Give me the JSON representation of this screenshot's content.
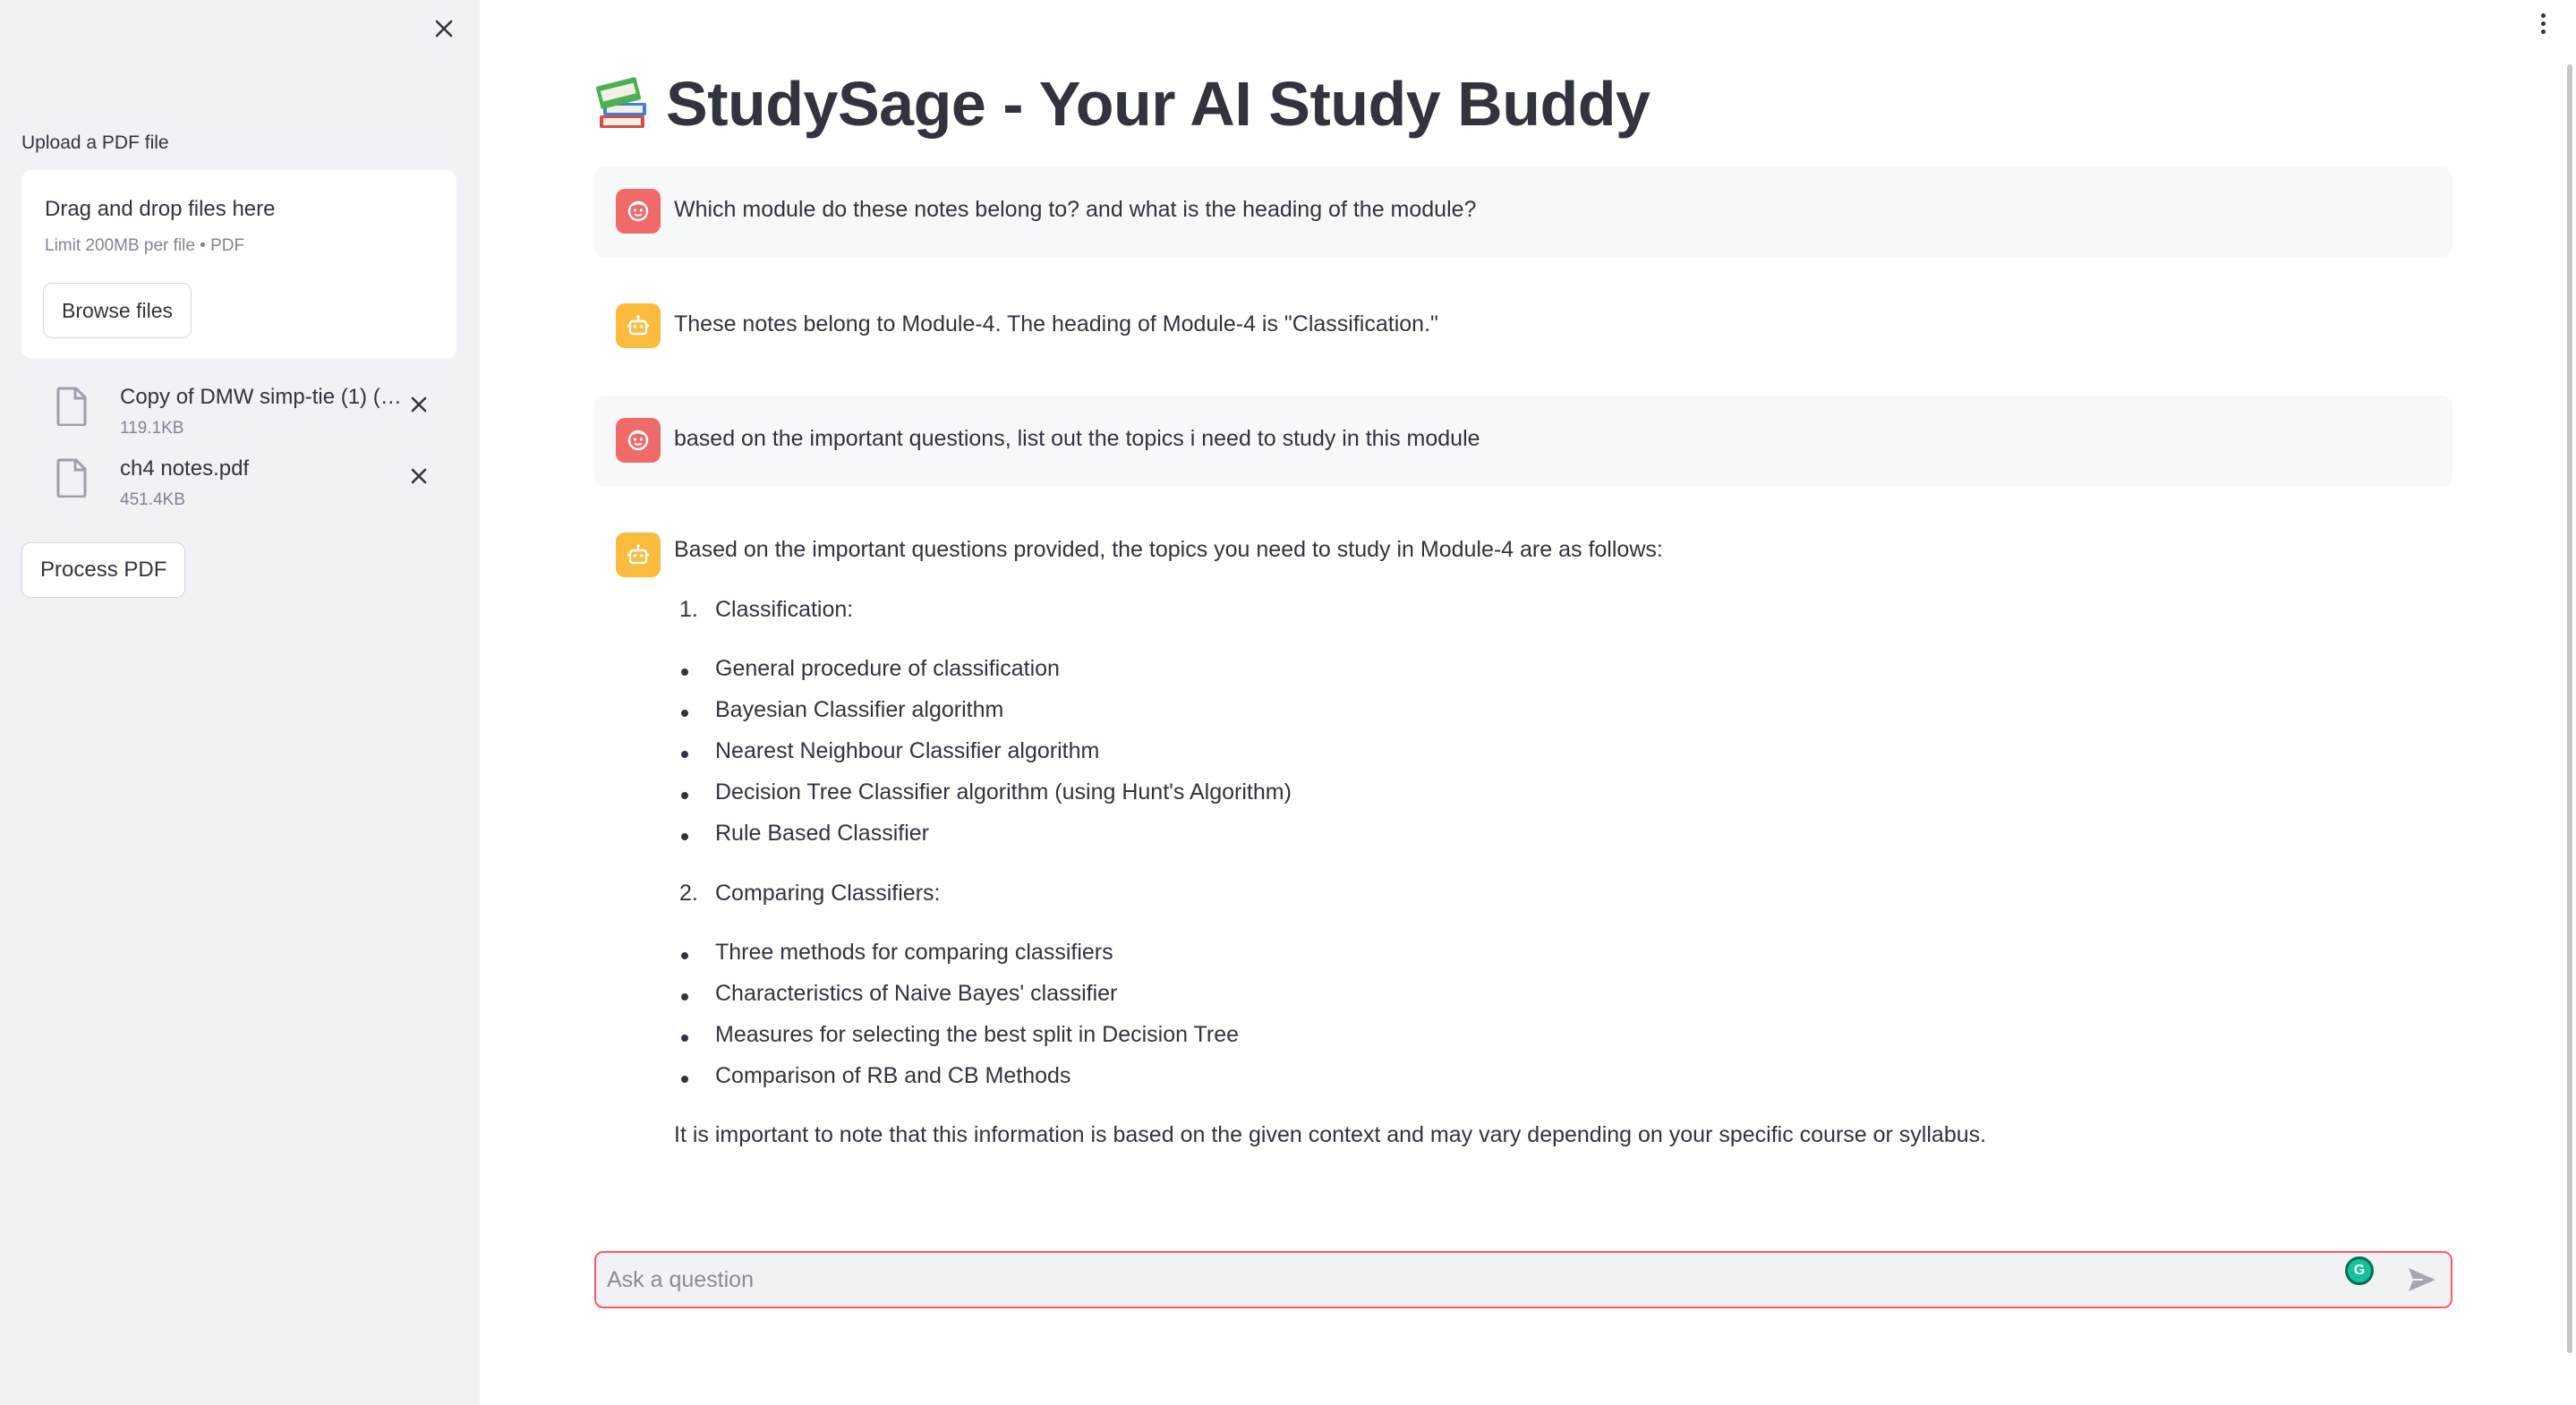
{
  "sidebar": {
    "upload_label": "Upload a PDF file",
    "dropzone": {
      "title": "Drag and drop files here",
      "limit": "Limit 200MB per file • PDF",
      "browse_label": "Browse files"
    },
    "files": [
      {
        "name": "Copy of DMW simp-tie (1) (1…",
        "size": "119.1KB"
      },
      {
        "name": "ch4 notes.pdf",
        "size": "451.4KB"
      }
    ],
    "process_label": "Process PDF"
  },
  "header": {
    "emoji": "books-emoji",
    "title": "StudySage - Your AI Study Buddy"
  },
  "messages": [
    {
      "role": "user",
      "text": "Which module do these notes belong to? and what is the heading of the module?"
    },
    {
      "role": "assistant",
      "text": "These notes belong to Module-4. The heading of Module-4 is \"Classification.\""
    },
    {
      "role": "user",
      "text": "based on the important questions, list out the topics i need to study in this module"
    },
    {
      "role": "assistant",
      "intro": "Based on the important questions provided, the topics you need to study in Module-4 are as follows:",
      "sections": [
        {
          "number": "1.",
          "heading": "Classification:",
          "items": [
            "General procedure of classification",
            "Bayesian Classifier algorithm",
            "Nearest Neighbour Classifier algorithm",
            "Decision Tree Classifier algorithm (using Hunt's Algorithm)",
            "Rule Based Classifier"
          ]
        },
        {
          "number": "2.",
          "heading": "Comparing Classifiers:",
          "items": [
            "Three methods for comparing classifiers",
            "Characteristics of Naive Bayes' classifier",
            "Measures for selecting the best split in Decision Tree",
            "Comparison of RB and CB Methods"
          ]
        }
      ],
      "outro": "It is important to note that this information is based on the given context and may vary depending on your specific course or syllabus."
    }
  ],
  "chat_input": {
    "placeholder": "Ask a question",
    "value": ""
  },
  "colors": {
    "sidebar_bg": "#f0f2f6",
    "user_avatar": "#f06a6a",
    "bot_avatar": "#fbbc3e",
    "input_border": "#ff5a5f"
  }
}
